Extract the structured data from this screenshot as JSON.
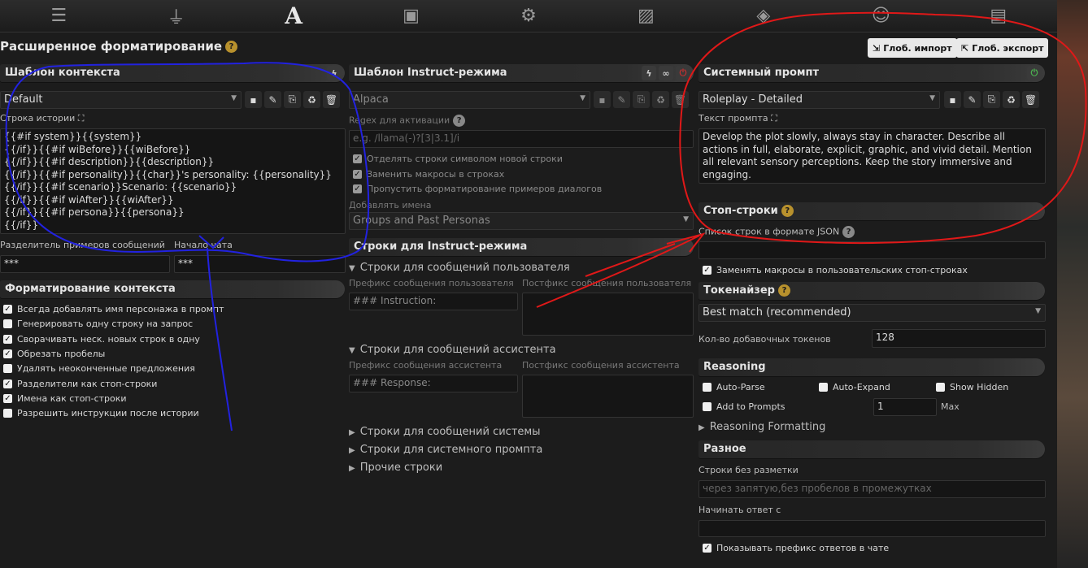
{
  "topbar": {
    "icons": [
      "sliders-icon",
      "plug-icon",
      "font-a-icon",
      "book-icon",
      "user-gear-icon",
      "image-icon",
      "cubes-icon",
      "smile-icon",
      "id-card-icon"
    ],
    "active_glyph": "A"
  },
  "page": {
    "title": "Расширенное форматирование",
    "global_import": "Глоб. импорт",
    "global_export": "Глоб. экспорт"
  },
  "context": {
    "header": "Шаблон контекста",
    "preset": "Default",
    "story_label": "Строка истории",
    "story_text": "{{#if system}}{{system}}\n{{/if}}{{#if wiBefore}}{{wiBefore}}\n{{/if}}{{#if description}}{{description}}\n{{/if}}{{#if personality}}{{char}}'s personality: {{personality}}\n{{/if}}{{#if scenario}}Scenario: {{scenario}}\n{{/if}}{{#if wiAfter}}{{wiAfter}}\n{{/if}}{{#if persona}}{{persona}}\n{{/if}}",
    "separator_label": "Разделитель примеров сообщений",
    "separator_value": "***",
    "chat_start_label": "Начало чата",
    "chat_start_value": "***",
    "format_header": "Форматирование контекста",
    "options": [
      {
        "label": "Всегда добавлять имя персонажа в промпт",
        "checked": true
      },
      {
        "label": "Генерировать одну строку на запрос",
        "checked": false
      },
      {
        "label": "Сворачивать неск. новых строк в одну",
        "checked": true
      },
      {
        "label": "Обрезать пробелы",
        "checked": true
      },
      {
        "label": "Удалять неоконченные предложения",
        "checked": false
      },
      {
        "label": "Разделители как стоп-строки",
        "checked": true
      },
      {
        "label": "Имена как стоп-строки",
        "checked": true
      },
      {
        "label": "Разрешить инструкции после истории",
        "checked": false
      }
    ]
  },
  "instruct": {
    "header": "Шаблон Instruct-режима",
    "preset": "Alpaca",
    "regex_label": "Regex для активации",
    "regex_placeholder": "e.g. /llama(-)?[3|3.1]/i",
    "options": [
      {
        "label": "Отделять строки символом новой строки",
        "checked": true
      },
      {
        "label": "Заменить макросы в строках",
        "checked": true
      },
      {
        "label": "Пропустить форматирование примеров диалогов",
        "checked": true
      }
    ],
    "names_label": "Добавлять имена",
    "names_value": "Groups and Past Personas",
    "strings_header": "Строки для Instruct-режима",
    "user_section": "Строки для сообщений пользователя",
    "user_prefix_label": "Префикс сообщения пользователя",
    "user_prefix_value": "### Instruction:",
    "user_suffix_label": "Постфикс сообщения пользователя",
    "assistant_section": "Строки для сообщений ассистента",
    "assistant_prefix_label": "Префикс сообщения ассистента",
    "assistant_prefix_value": "### Response:",
    "assistant_suffix_label": "Постфикс сообщения ассистента",
    "collapsed": [
      "Строки для сообщений системы",
      "Строки для системного промпта",
      "Прочие строки"
    ]
  },
  "system": {
    "header": "Системный промпт",
    "preset": "Roleplay - Detailed",
    "text_label": "Текст промпта",
    "text": "Develop the plot slowly, always stay in character. Describe all actions in full, elaborate, explicit, graphic, and vivid detail. Mention all relevant sensory perceptions. Keep the story immersive and engaging.",
    "stop_header": "Стоп-строки",
    "stop_label": "Список строк в формате JSON",
    "stop_macros": "Заменять макросы в пользовательских стоп-строках",
    "tokenizer_header": "Токенайзер",
    "tokenizer_value": "Best match (recommended)",
    "padding_label": "Кол-во добавочных токенов",
    "padding_value": "128",
    "reasoning_header": "Reasoning",
    "auto_parse": "Auto-Parse",
    "auto_expand": "Auto-Expand",
    "show_hidden": "Show Hidden",
    "add_to_prompts": "Add to Prompts",
    "max_value": "1",
    "max_label": "Max",
    "reasoning_formatting": "Reasoning Formatting",
    "misc_header": "Разное",
    "nonmarkdown_label": "Строки без разметки",
    "nonmarkdown_placeholder": "через запятую,без пробелов в промежутках",
    "start_reply_label": "Начинать ответ с",
    "show_prefix": "Показывать префикс ответов в чате"
  }
}
